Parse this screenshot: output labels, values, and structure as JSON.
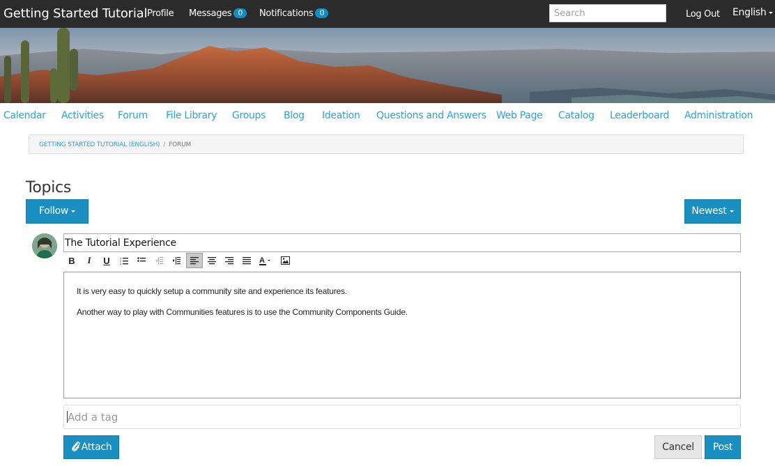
{
  "topbar": {
    "brand": "Getting Started Tutorial",
    "profile": "Profile",
    "messages_label": "Messages",
    "messages_count": "0",
    "notifications_label": "Notifications",
    "notifications_count": "0",
    "search_placeholder": "Search",
    "logout": "Log Out",
    "language": "English"
  },
  "subnav": {
    "items": [
      "Calendar",
      "Activities",
      "Forum",
      "File Library",
      "Groups",
      "Blog",
      "Ideation",
      "Questions and Answers",
      "Web Page",
      "Catalog",
      "Leaderboard",
      "Administration"
    ]
  },
  "breadcrumb": {
    "root": "GETTING STARTED TUTORIAL (ENGLISH)",
    "separator": "/",
    "current": "FORUM"
  },
  "page": {
    "title": "Topics",
    "follow_label": "Follow",
    "sort_label": "Newest"
  },
  "composer": {
    "title_value": "The Tutorial Experience",
    "body": [
      "It is very easy to quickly setup a community site and experience its features.",
      "Another way to play with Communities features is to use the Community Components Guide."
    ],
    "tag_placeholder": "Add a tag",
    "attach_label": "Attach",
    "cancel_label": "Cancel",
    "post_label": "Post"
  },
  "toolbar": {
    "icons": [
      "bold-icon",
      "italic-icon",
      "underline-icon",
      "ordered-list-icon",
      "unordered-list-icon",
      "outdent-icon",
      "indent-icon",
      "align-left-icon",
      "align-center-icon",
      "align-right-icon",
      "justify-icon",
      "text-color-icon",
      "image-icon"
    ]
  },
  "colors": {
    "accent": "#1a8fc1",
    "link": "#2aa3d6",
    "topbar": "#2b2b2b"
  }
}
